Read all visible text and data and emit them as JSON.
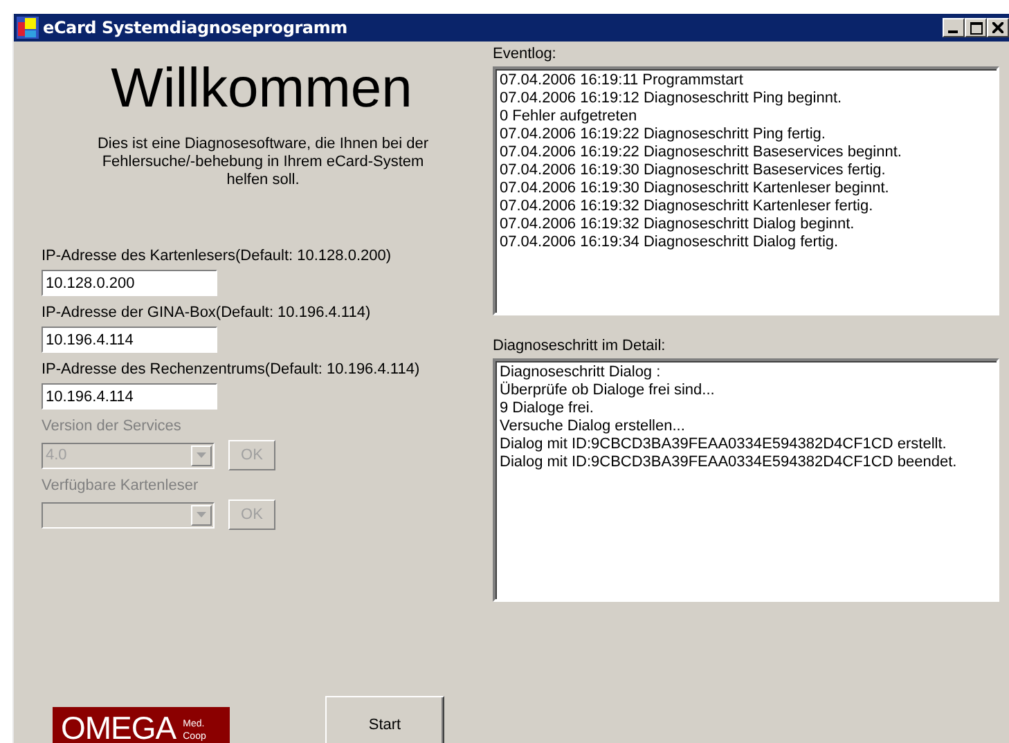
{
  "window": {
    "title": "eCard Systemdiagnoseprogramm"
  },
  "welcome": {
    "heading": "Willkommen",
    "description": "Dies ist eine Diagnosesoftware, die Ihnen bei der Fehlersuche/-behebung in Ihrem eCard-System helfen soll."
  },
  "fields": [
    {
      "kind": "text",
      "label": "IP-Adresse  des Kartenlesers(Default:  10.128.0.200)",
      "value": "10.128.0.200",
      "disabled": false
    },
    {
      "kind": "text",
      "label": "IP-Adresse  der GINA-Box(Default:  10.196.4.114)",
      "value": "10.196.4.114",
      "disabled": false
    },
    {
      "kind": "text",
      "label": "IP-Adresse  des Rechenzentrums(Default:  10.196.4.114)",
      "value": "10.196.4.114",
      "disabled": false
    },
    {
      "kind": "dropdown",
      "label": "Version der Services",
      "value": "4.0",
      "disabled": true,
      "button": "OK"
    },
    {
      "kind": "dropdown",
      "label": "Verfügbare Kartenleser",
      "disabled": true,
      "button": "OK"
    }
  ],
  "eventlog": {
    "label": "Eventlog:",
    "lines": [
      "07.04.2006 16:19:11 Programmstart",
      "07.04.2006 16:19:12 Diagnoseschritt Ping beginnt.",
      "0 Fehler aufgetreten",
      "07.04.2006 16:19:22 Diagnoseschritt Ping fertig.",
      "07.04.2006 16:19:22 Diagnoseschritt Baseservices beginnt.",
      "07.04.2006 16:19:30 Diagnoseschritt Baseservices fertig.",
      "07.04.2006 16:19:30 Diagnoseschritt Kartenleser beginnt.",
      "07.04.2006 16:19:32 Diagnoseschritt Kartenleser fertig.",
      "07.04.2006 16:19:32 Diagnoseschritt Dialog  beginnt.",
      "07.04.2006 16:19:34 Diagnoseschritt Dialog  fertig."
    ]
  },
  "detail": {
    "label": "Diagnoseschritt im Detail:",
    "lines": [
      "Diagnoseschritt Dialog :",
      "Überprüfe ob Dialoge frei sind...",
      "9 Dialoge frei.",
      "Versuche Dialog erstellen...",
      "Dialog mit ID:9CBCD3BA39FEAA0334E594382D4CF1CD  erstellt.",
      "Dialog mit ID:9CBCD3BA39FEAA0334E594382D4CF1CD  beendet."
    ]
  },
  "logo": {
    "name": "OMEGA",
    "tagline_1": "Med.",
    "tagline_2": "Coop"
  },
  "start_button": "Start"
}
